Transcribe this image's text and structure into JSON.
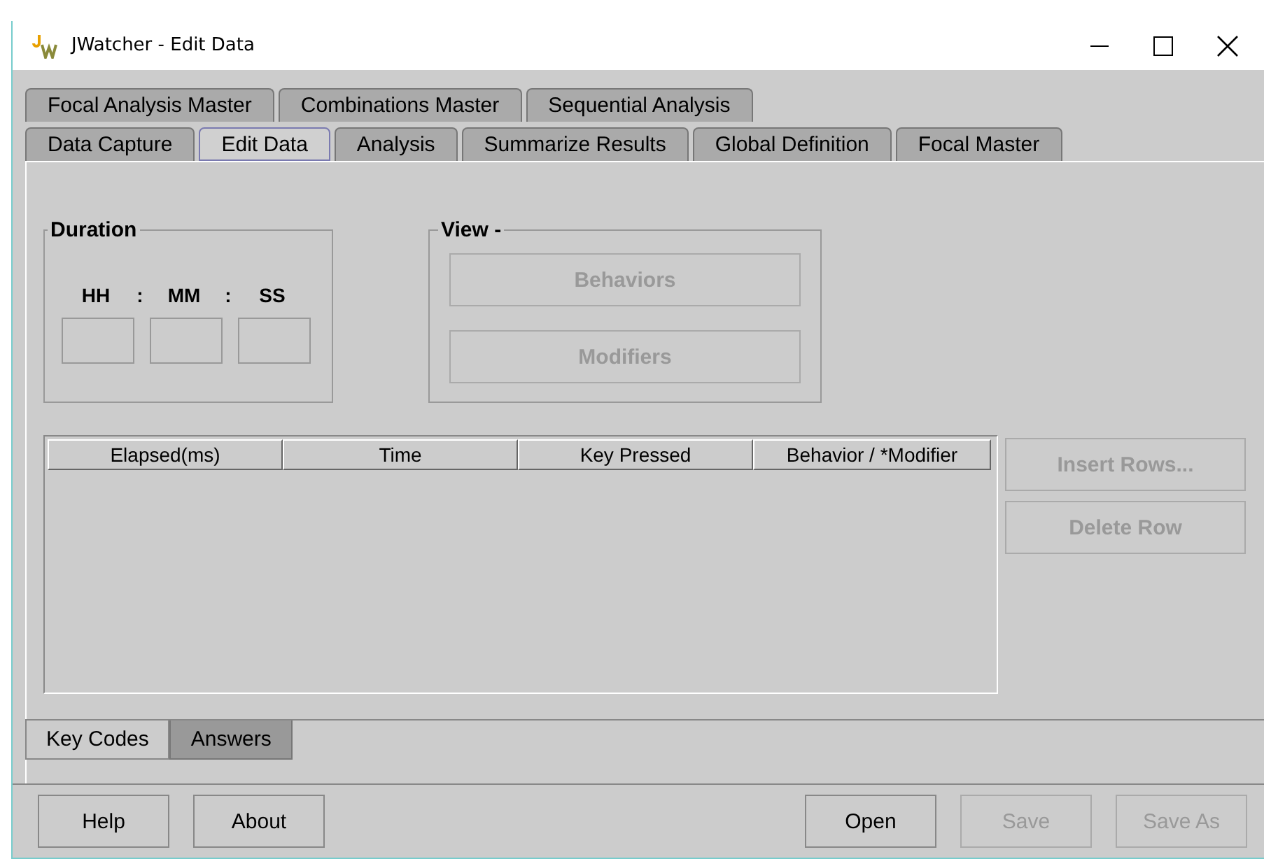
{
  "window": {
    "title": "JWatcher - Edit Data"
  },
  "tab_rows": [
    [
      {
        "label": "Focal Analysis Master",
        "selected": false
      },
      {
        "label": "Combinations Master",
        "selected": false
      },
      {
        "label": "Sequential Analysis",
        "selected": false
      }
    ],
    [
      {
        "label": "Data Capture",
        "selected": false
      },
      {
        "label": "Edit Data",
        "selected": true
      },
      {
        "label": "Analysis",
        "selected": false
      },
      {
        "label": "Summarize Results",
        "selected": false
      },
      {
        "label": "Global Definition",
        "selected": false
      },
      {
        "label": "Focal Master",
        "selected": false
      }
    ]
  ],
  "duration": {
    "title": "Duration",
    "fields": [
      {
        "label": "HH"
      },
      {
        "label": "MM"
      },
      {
        "label": "SS"
      }
    ],
    "separator": ":"
  },
  "view": {
    "title": "View -",
    "buttons": [
      {
        "label": "Behaviors",
        "disabled": true
      },
      {
        "label": "Modifiers",
        "disabled": true
      }
    ]
  },
  "table": {
    "columns": [
      "Elapsed(ms)",
      "Time",
      "Key  Pressed",
      "Behavior / *Modifier"
    ]
  },
  "row_buttons": [
    {
      "label": "Insert Rows...",
      "disabled": true
    },
    {
      "label": "Delete Row",
      "disabled": true
    }
  ],
  "bottom_tabs": [
    {
      "label": "Key Codes",
      "selected": true
    },
    {
      "label": "Answers",
      "selected": false
    }
  ],
  "footer_left": [
    {
      "label": "Help",
      "disabled": false
    },
    {
      "label": "About",
      "disabled": false
    }
  ],
  "footer_right": [
    {
      "label": "Open",
      "disabled": false
    },
    {
      "label": "Save",
      "disabled": true
    },
    {
      "label": "Save As",
      "disabled": true
    }
  ]
}
